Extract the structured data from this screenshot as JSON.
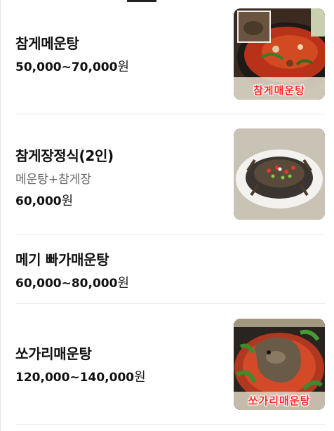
{
  "menu": {
    "items": [
      {
        "name": "참게메운탕",
        "price": "50,000~70,000",
        "currency": "원",
        "photo_caption": "참게매운탕"
      },
      {
        "name": "참게장정식(2인)",
        "description": "메운탕+참게장",
        "price": "60,000",
        "currency": "원"
      },
      {
        "name": "메기 빠가매운탕",
        "price": "60,000~80,000",
        "currency": "원"
      },
      {
        "name": "쏘가리매운탕",
        "price": "120,000~140,000",
        "currency": "원",
        "photo_caption": "쏘가리매운탕"
      }
    ]
  }
}
